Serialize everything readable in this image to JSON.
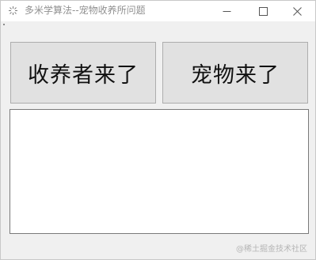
{
  "window": {
    "title": "多米学算法--宠物收养所问题",
    "icon": "app-sparkle-icon",
    "controls": {
      "minimize_icon": "minimize-icon",
      "maximize_icon": "maximize-icon",
      "close_icon": "close-icon"
    }
  },
  "buttons": {
    "adopter_label": "收养者来了",
    "pet_label": "宠物来了"
  },
  "output": {
    "text": ""
  },
  "watermark": {
    "text": "@稀土掘金技术社区"
  },
  "colors": {
    "window_bg": "#f0f0f0",
    "button_bg": "#e1e1e1",
    "button_border": "#adadad",
    "output_bg": "#ffffff",
    "title_text": "#909090"
  }
}
